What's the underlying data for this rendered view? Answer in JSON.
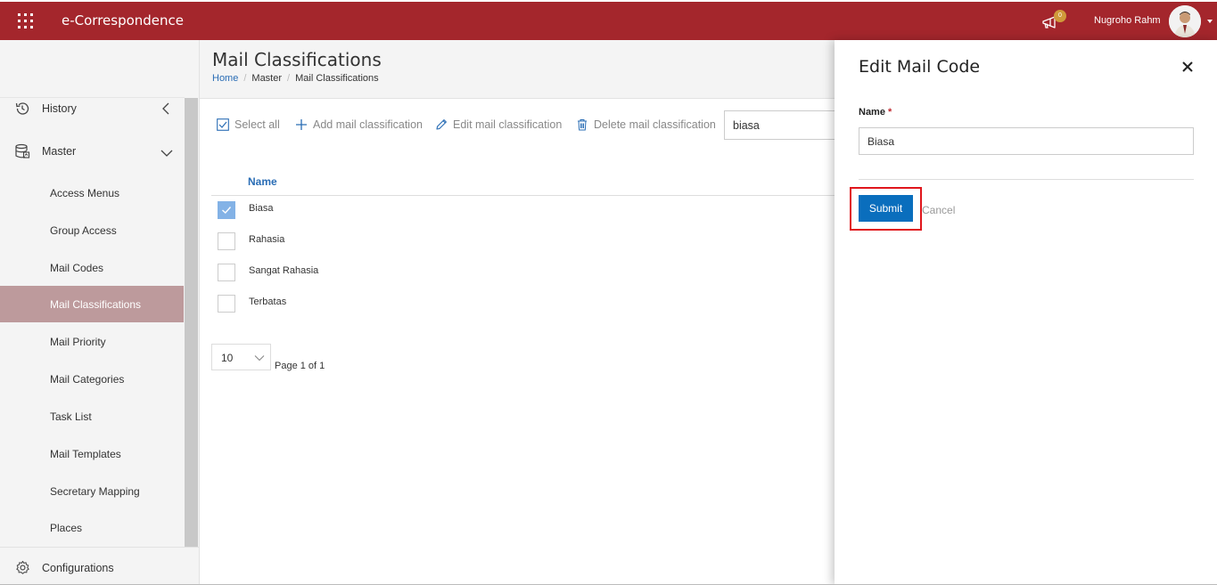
{
  "topbar": {
    "app_title": "e-Correspondence",
    "notification_count": "0",
    "user_name": "Nugroho Rahm",
    "brand_color": "#a4262c"
  },
  "sidebar": {
    "groups": [
      {
        "label": "History",
        "icon": "history-icon"
      },
      {
        "label": "Master",
        "icon": "database-icon"
      },
      {
        "label": "Configurations",
        "icon": "gear-icon"
      }
    ],
    "items": [
      {
        "label": "Access Menus"
      },
      {
        "label": "Group Access"
      },
      {
        "label": "Mail Codes"
      },
      {
        "label": "Mail Classifications",
        "active": true
      },
      {
        "label": "Mail Priority"
      },
      {
        "label": "Mail Categories"
      },
      {
        "label": "Task List"
      },
      {
        "label": "Mail Templates"
      },
      {
        "label": "Secretary Mapping"
      },
      {
        "label": "Places"
      }
    ],
    "active_color": "#bd9a9c"
  },
  "page": {
    "title": "Mail Classifications",
    "breadcrumb": [
      "Home",
      "Master",
      "Mail Classifications"
    ]
  },
  "toolbar": {
    "select_all": "Select all",
    "add": "Add mail classification",
    "edit": "Edit mail classification",
    "delete": "Delete mail classification",
    "search_value": "biasa"
  },
  "grid": {
    "column_name": "Name",
    "rows": [
      {
        "name": "Biasa",
        "checked": true
      },
      {
        "name": "Rahasia",
        "checked": false
      },
      {
        "name": "Sangat Rahasia",
        "checked": false
      },
      {
        "name": "Terbatas",
        "checked": false
      }
    ],
    "page_size": "10",
    "page_info": "Page 1 of 1"
  },
  "panel": {
    "title": "Edit Mail Code",
    "name_label": "Name",
    "required_mark": "*",
    "name_value": "Biasa",
    "submit_label": "Submit",
    "cancel_label": "Cancel",
    "accent_color": "#0a6ebd",
    "highlight_color": "#e0161c"
  }
}
